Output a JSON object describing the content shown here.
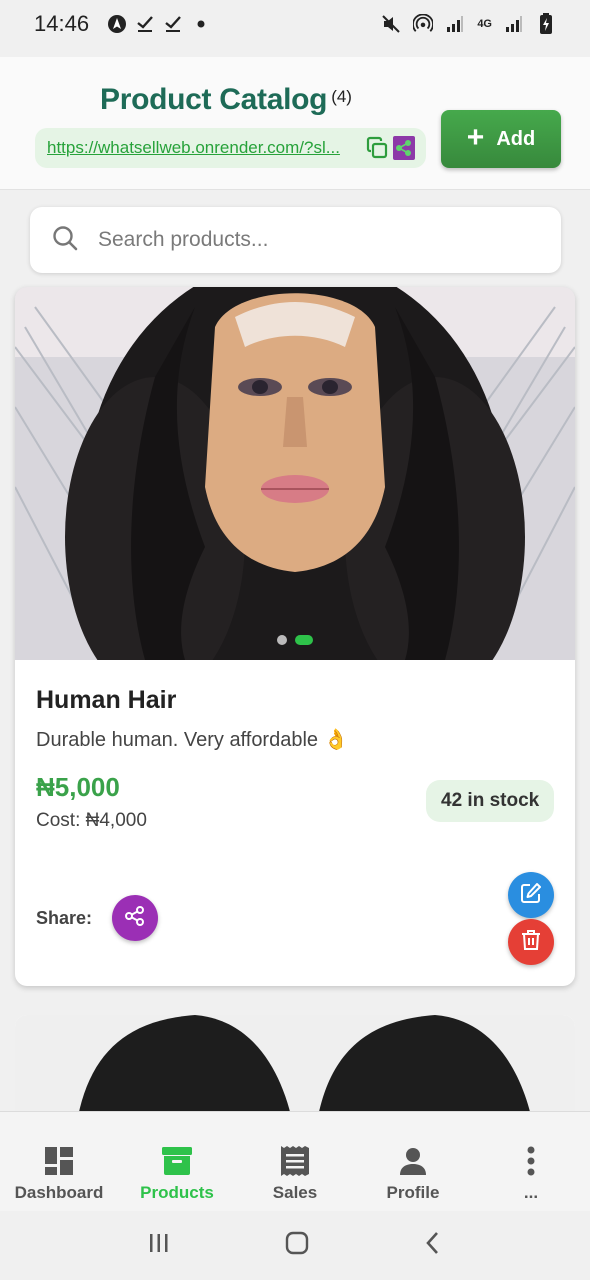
{
  "status_bar": {
    "time": "14:46",
    "icons": [
      "navigation-icon",
      "check-icon",
      "check-icon",
      "dot-icon",
      "mute-icon",
      "hotspot-icon",
      "signal-icon",
      "4g-icon",
      "signal-icon",
      "battery-icon"
    ],
    "network": "4G"
  },
  "header": {
    "title": "Product Catalog",
    "count": "(4)",
    "store_link": "https://whatsellweb.onrender.com/?sl...",
    "add_label": "Add"
  },
  "search": {
    "placeholder": "Search products..."
  },
  "products": [
    {
      "name": "Human Hair",
      "description": "Durable human. Very affordable 👌",
      "price": "₦5,000",
      "cost": "Cost: ₦4,000",
      "stock": "42 in stock",
      "share_label": "Share:",
      "image_count": 2,
      "active_image": 2
    }
  ],
  "bottom_nav": [
    {
      "label": "Dashboard",
      "icon": "dashboard-icon",
      "active": false
    },
    {
      "label": "Products",
      "icon": "archive-box-icon",
      "active": true
    },
    {
      "label": "Sales",
      "icon": "receipt-icon",
      "active": false
    },
    {
      "label": "Profile",
      "icon": "person-icon",
      "active": false
    },
    {
      "label": "...",
      "icon": "more-vertical-icon",
      "active": false
    }
  ],
  "colors": {
    "primary_green": "#2ec24a",
    "title_green": "#1e6b57",
    "share_purple": "#9b2fb5",
    "edit_blue": "#2a8ee0",
    "delete_red": "#e53f36"
  }
}
